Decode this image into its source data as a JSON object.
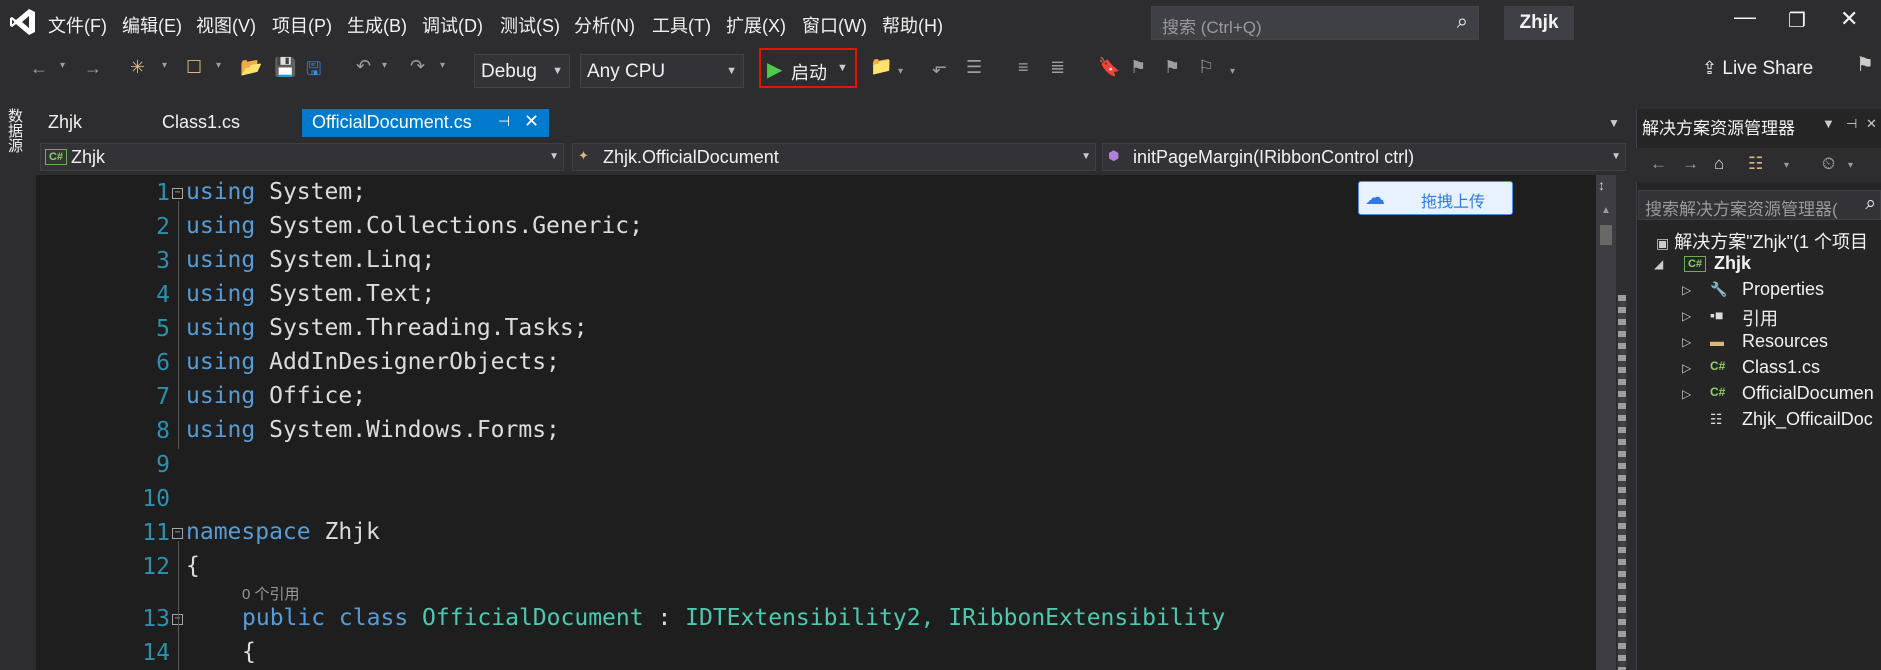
{
  "menu": [
    "文件(F)",
    "编辑(E)",
    "视图(V)",
    "项目(P)",
    "生成(B)",
    "调试(D)",
    "测试(S)",
    "分析(N)",
    "工具(T)",
    "扩展(X)",
    "窗口(W)",
    "帮助(H)"
  ],
  "search": {
    "placeholder": "搜索 (Ctrl+Q)"
  },
  "project_name": "Zhjk",
  "toolbar": {
    "config": "Debug",
    "platform": "Any CPU",
    "start_label": "启动",
    "live_share": "Live Share"
  },
  "left_strip": {
    "datasource": "数据源"
  },
  "tabs": [
    {
      "label": "Zhjk",
      "active": false
    },
    {
      "label": "Class1.cs",
      "active": false
    },
    {
      "label": "OfficialDocument.cs",
      "active": true
    }
  ],
  "navbar": {
    "project": "Zhjk",
    "class": "Zhjk.OfficialDocument",
    "member": "initPageMargin(IRibbonControl ctrl)",
    "project_icon": "C#"
  },
  "upload_button": "拖拽上传",
  "code": {
    "line_numbers": [
      "1",
      "2",
      "3",
      "4",
      "5",
      "6",
      "7",
      "8",
      "9",
      "10",
      "11",
      "12",
      "13",
      "14"
    ],
    "using_keyword": "using",
    "usings": [
      "System;",
      "System.Collections.Generic;",
      "System.Linq;",
      "System.Text;",
      "System.Threading.Tasks;",
      "AddInDesignerObjects;",
      "Office;",
      "System.Windows.Forms;"
    ],
    "namespace_keyword": "namespace",
    "namespace_name": "Zhjk",
    "open_brace": "{",
    "refs_lens": "0 个引用",
    "class_modifiers": "public class",
    "class_name": "OfficialDocument",
    "class_separator": " : ",
    "class_bases": "IDTExtensibility2, IRibbonExtensibility",
    "class_open_brace": "{"
  },
  "solution_explorer": {
    "title": "解决方案资源管理器",
    "search_placeholder": "搜索解决方案资源管理器(",
    "solution_label": "解决方案\"Zhjk\"(1 个项目",
    "project": "Zhjk",
    "project_icon": "C#",
    "items": [
      "Properties",
      "引用",
      "Resources",
      "Class1.cs",
      "OfficialDocumen",
      "Zhjk_OfficailDoc"
    ],
    "cs_icon": "C#"
  },
  "colors": {
    "accent": "#007acc",
    "keyword": "#569cd6",
    "type": "#4ec9b0",
    "line_number": "#2b91af",
    "highlight_border": "#e51400"
  }
}
